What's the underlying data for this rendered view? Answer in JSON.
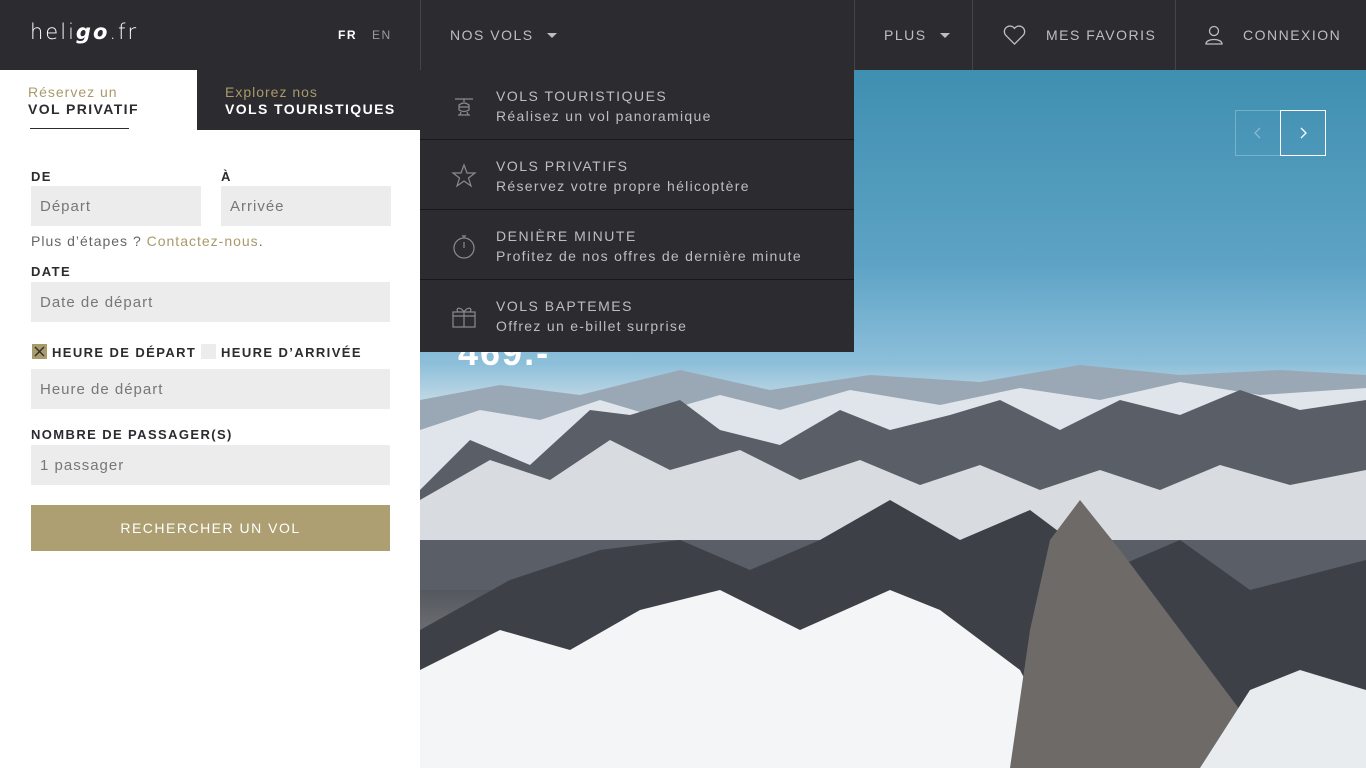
{
  "header": {
    "logo": {
      "pre": "heli",
      "bold": "go",
      "post": ".fr"
    },
    "lang_fr": "FR",
    "lang_en": "EN",
    "nos_vols": "NOS VOLS",
    "plus": "PLUS",
    "favoris": "MES FAVORIS",
    "connexion": "CONNEXION"
  },
  "tabs": {
    "active": {
      "small": "Réservez un",
      "big": "VOL PRIVATIF"
    },
    "inactive": {
      "small": "Explorez nos",
      "big": "VOLS TOURISTIQUES"
    }
  },
  "form": {
    "de_label": "DE",
    "a_label": "À",
    "depart_placeholder": "Départ",
    "arrivee_placeholder": "Arrivée",
    "hint_text": "Plus d’étapes ? ",
    "hint_link": "Contactez-nous",
    "hint_end": ".",
    "date_label": "DATE",
    "date_placeholder": "Date de départ",
    "heure_depart_label": "HEURE DE DÉPART",
    "heure_arrivee_label": "HEURE D’ARRIVÉE",
    "heure_placeholder": "Heure de départ",
    "passagers_label": "NOMBRE DE PASSAGER(S)",
    "passagers_value": "1 passager",
    "search_button": "RECHERCHER UN VOL"
  },
  "hero": {
    "price": "469.-"
  },
  "dropdown": [
    {
      "title": "VOLS TOURISTIQUES",
      "subtitle": "Réalisez un vol panoramique",
      "icon": "helicopter-icon"
    },
    {
      "title": "VOLS PRIVATIFS",
      "subtitle": "Réservez votre propre hélicoptère",
      "icon": "star-icon"
    },
    {
      "title": "DENIÈRE MINUTE",
      "subtitle": "Profitez de nos offres de dernière minute",
      "icon": "stopwatch-icon"
    },
    {
      "title": "VOLS BAPTEMES",
      "subtitle": "Offrez un e-billet surprise",
      "icon": "gift-icon"
    }
  ],
  "colors": {
    "dark": "#2b2b30",
    "accent": "#ad9f72",
    "field": "#ececec"
  }
}
